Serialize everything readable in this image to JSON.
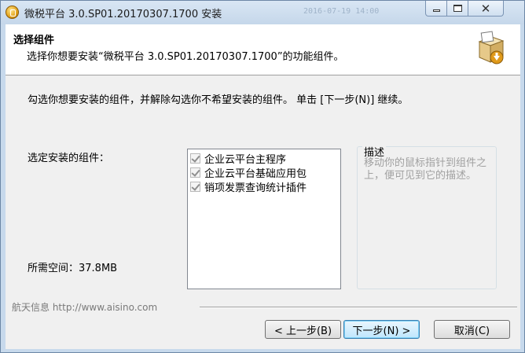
{
  "window": {
    "title": "微税平台 3.0.SP01.20170307.1700 安装",
    "title_ghost_text": "2016-07-19 14:00"
  },
  "header": {
    "title": "选择组件",
    "subtitle": "选择你想要安装“微税平台 3.0.SP01.20170307.1700”的功能组件。",
    "icon": "installer-box-icon"
  },
  "body": {
    "intro": "勾选你想要安装的组件，并解除勾选你不希望安装的组件。 单击 [下一步(N)] 继续。",
    "select_label": "选定安装的组件：",
    "space_label": "所需空间：37.8MB"
  },
  "components": [
    {
      "label": "企业云平台主程序",
      "checked": true
    },
    {
      "label": "企业云平台基础应用包",
      "checked": true
    },
    {
      "label": "销项发票查询统计插件",
      "checked": true
    }
  ],
  "description": {
    "title": "描述",
    "text": "移动你的鼠标指针到组件之上，便可见到它的描述。"
  },
  "footer": {
    "brand": "航天信息 http://www.aisino.com"
  },
  "buttons": {
    "back": "< 上一步(B)",
    "next": "下一步(N) >",
    "cancel": "取消(C)"
  },
  "controls": {
    "close_glyph": "✕"
  }
}
